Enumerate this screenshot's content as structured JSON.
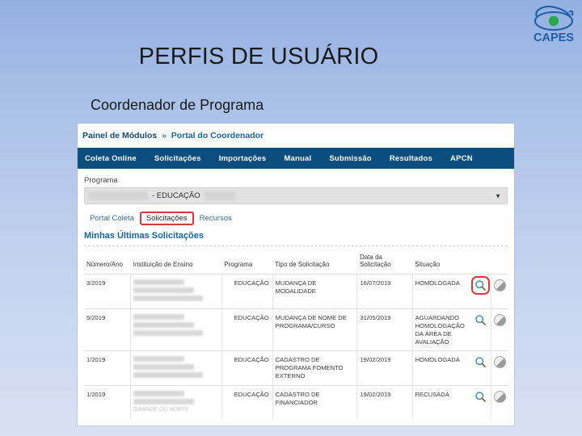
{
  "slide": {
    "title": "PERFIS DE USUÁRIO",
    "subtitle": "Coordenador de Programa"
  },
  "logo": {
    "name": "capes-logo",
    "text": "CAPES",
    "ring_color": "#1f5fa8",
    "dot_color": "#2aa84a"
  },
  "screenshot": {
    "breadcrumb": {
      "root": "Painel de Módulos",
      "separator": "»",
      "current": "Portal do Coordenador"
    },
    "nav_items": [
      "Coleta Online",
      "Solicitações",
      "Importações",
      "Manual",
      "Submissão",
      "Resultados",
      "APCN"
    ],
    "program_field": {
      "label": "Programa",
      "value": "- EDUCAÇÃO",
      "caret": "▼"
    },
    "tabs": [
      {
        "label": "Portal Coleta",
        "active": false
      },
      {
        "label": "Solicitações",
        "active": true
      },
      {
        "label": "Recursos",
        "active": false
      }
    ],
    "section_title": "Minhas Últimas Solicitações",
    "table": {
      "columns": [
        "Número/Ano",
        "Instituição de Ensino",
        "Programa",
        "Tipo de Solicitação",
        "Data da Solicitação",
        "Situação"
      ],
      "rows": [
        {
          "numero_ano": "3/2019",
          "instituicao": "",
          "programa": "EDUCAÇÃO",
          "tipo": "MUDANÇA DE MODALIDADE",
          "data": "16/07/2019",
          "situacao": "HOMOLOGADA",
          "highlighted": true
        },
        {
          "numero_ano": "5/2019",
          "instituicao": "",
          "programa": "EDUCAÇÃO",
          "tipo": "MUDANÇA DE NOME DE PROGRAMA/CURSO",
          "data": "31/05/2019",
          "situacao": "AGUARDANDO HOMOLOGAÇÃO DA ÁREA DE AVALIAÇÃO",
          "highlighted": false
        },
        {
          "numero_ano": "1/2019",
          "instituicao": "",
          "programa": "EDUCAÇÃO",
          "tipo": "CADASTRO DE PROGRAMA FOMENTO EXTERNO",
          "data": "19/02/2019",
          "situacao": "HOMOLOGADA",
          "highlighted": false
        },
        {
          "numero_ano": "1/2019",
          "instituicao": "GRANDE DO NORTE",
          "programa": "EDUCAÇÃO",
          "tipo": "CADASTRO DE FINANCIADOR",
          "data": "19/02/2019",
          "situacao": "RECUSADA",
          "highlighted": false
        }
      ]
    },
    "colors": {
      "nav_bar": "#0b4d7d",
      "link_blue": "#1565a8",
      "highlight_red": "#d63a36"
    }
  }
}
